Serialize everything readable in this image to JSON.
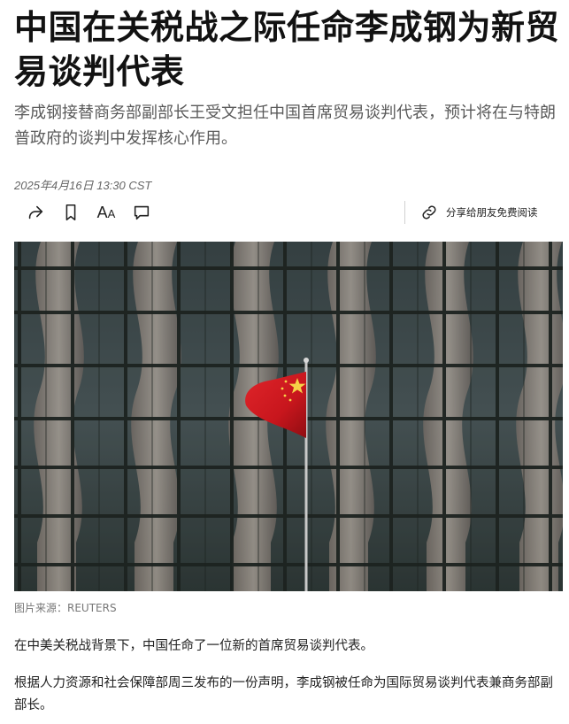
{
  "article": {
    "headline": "中国在关税战之际任命李成钢为新贸易谈判代表",
    "summary": "李成钢接替商务部副部长王受文担任中国首席贸易谈判代表，预计将在与特朗普政府的谈判中发挥核心作用。",
    "dateline": "2025年4月16日 13:30 CST",
    "photo_credit": "图片来源：REUTERS",
    "paragraphs": [
      "在中美关税战背景下，中国任命了一位新的首席贸易谈判代表。",
      "根据人力资源和社会保障部周三发布的一份声明，李成钢被任命为国际贸易谈判代表兼商务部副部长。"
    ]
  },
  "toolbar": {
    "icons": [
      "share-icon",
      "bookmark-icon",
      "font-size-icon",
      "comment-icon",
      "link-icon"
    ],
    "font_size_label_large": "A",
    "font_size_label_small": "A",
    "gift_label": "分享给朋友免费阅读"
  },
  "photo": {
    "subject": "glass-facade-with-chinese-flag",
    "colors": {
      "flag_red": "#c8161d",
      "star_yellow": "#f6d247",
      "frame_dark": "#1d2320"
    }
  }
}
